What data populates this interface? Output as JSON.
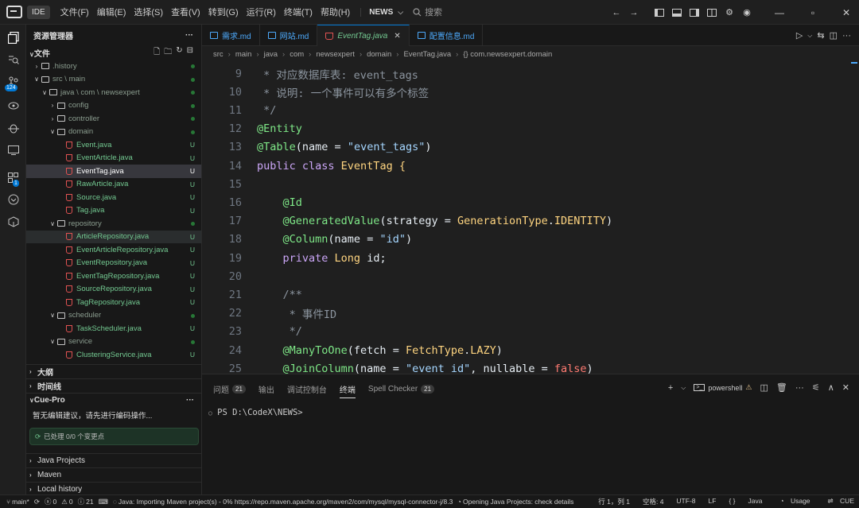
{
  "titlebar": {
    "ide_label": "IDE",
    "menu": [
      "文件(F)",
      "编辑(E)",
      "选择(S)",
      "查看(V)",
      "转到(G)",
      "运行(R)",
      "终端(T)",
      "帮助(H)"
    ],
    "project": "NEWS",
    "search_placeholder": "搜索"
  },
  "activity": {
    "scm_badge": "124",
    "ext_badge": "1"
  },
  "sidebar": {
    "title": "资源管理器",
    "section_files": "文件",
    "tree": [
      {
        "label": ".history",
        "kind": "folder",
        "depth": 1,
        "open": false,
        "status": "dot"
      },
      {
        "label": "src \\ main",
        "kind": "folder",
        "depth": 1,
        "open": true,
        "status": "dot"
      },
      {
        "label": "java \\ com \\ newsexpert",
        "kind": "folder",
        "depth": 2,
        "open": true,
        "status": "dot"
      },
      {
        "label": "config",
        "kind": "folder",
        "depth": 3,
        "open": false,
        "status": "dot"
      },
      {
        "label": "controller",
        "kind": "folder",
        "depth": 3,
        "open": false,
        "status": "dot"
      },
      {
        "label": "domain",
        "kind": "folder",
        "depth": 3,
        "open": true,
        "status": "dot"
      },
      {
        "label": "Event.java",
        "kind": "java",
        "depth": 4,
        "status": "U"
      },
      {
        "label": "EventArticle.java",
        "kind": "java",
        "depth": 4,
        "status": "U"
      },
      {
        "label": "EventTag.java",
        "kind": "java",
        "depth": 4,
        "status": "U",
        "selected": true
      },
      {
        "label": "RawArticle.java",
        "kind": "java",
        "depth": 4,
        "status": "U"
      },
      {
        "label": "Source.java",
        "kind": "java",
        "depth": 4,
        "status": "U"
      },
      {
        "label": "Tag.java",
        "kind": "java",
        "depth": 4,
        "status": "U"
      },
      {
        "label": "repository",
        "kind": "folder",
        "depth": 3,
        "open": true,
        "status": "dot"
      },
      {
        "label": "ArticleRepository.java",
        "kind": "java",
        "depth": 4,
        "status": "U",
        "hover": true
      },
      {
        "label": "EventArticleRepository.java",
        "kind": "java",
        "depth": 4,
        "status": "U"
      },
      {
        "label": "EventRepository.java",
        "kind": "java",
        "depth": 4,
        "status": "U"
      },
      {
        "label": "EventTagRepository.java",
        "kind": "java",
        "depth": 4,
        "status": "U"
      },
      {
        "label": "SourceRepository.java",
        "kind": "java",
        "depth": 4,
        "status": "U"
      },
      {
        "label": "TagRepository.java",
        "kind": "java",
        "depth": 4,
        "status": "U"
      },
      {
        "label": "scheduler",
        "kind": "folder",
        "depth": 3,
        "open": true,
        "status": "dot"
      },
      {
        "label": "TaskScheduler.java",
        "kind": "java",
        "depth": 4,
        "status": "U"
      },
      {
        "label": "service",
        "kind": "folder",
        "depth": 3,
        "open": true,
        "status": "dot"
      },
      {
        "label": "ClusteringService.java",
        "kind": "java",
        "depth": 4,
        "status": "U"
      }
    ],
    "outline": "大纲",
    "timeline": "时间线",
    "cue_title": "Cue-Pro",
    "cue_message": "暂无编辑建议，请先进行编码操作...",
    "cue_status": "已处理 0/0 个变更点",
    "java_projects": "Java Projects",
    "maven": "Maven",
    "local_history": "Local history"
  },
  "tabs": [
    {
      "label": "需求.md",
      "kind": "md"
    },
    {
      "label": "网站.md",
      "kind": "md"
    },
    {
      "label": "EventTag.java",
      "kind": "java",
      "active": true
    },
    {
      "label": "配置信息.md",
      "kind": "md"
    }
  ],
  "breadcrumb": [
    "src",
    "main",
    "java",
    "com",
    "newsexpert",
    "domain",
    "EventTag.java",
    "{} com.newsexpert.domain"
  ],
  "code": {
    "lines": [
      {
        "n": "9",
        "tokens": [
          [
            "cm",
            " * 对应数据库表: event_tags"
          ]
        ]
      },
      {
        "n": "10",
        "tokens": [
          [
            "cm",
            " * 说明: 一个事件可以有多个标签"
          ]
        ]
      },
      {
        "n": "11",
        "tokens": [
          [
            "cm",
            " */"
          ]
        ]
      },
      {
        "n": "12",
        "tokens": [
          [
            "ann",
            "@Entity"
          ]
        ]
      },
      {
        "n": "13",
        "tokens": [
          [
            "ann",
            "@Table"
          ],
          [
            "plain",
            "(name = "
          ],
          [
            "str",
            "\"event_tags\""
          ],
          [
            "plain",
            ")"
          ]
        ]
      },
      {
        "n": "14",
        "tokens": [
          [
            "kw2",
            "public class "
          ],
          [
            "typ",
            "EventTag "
          ],
          [
            "typ",
            "{"
          ]
        ]
      },
      {
        "n": "15",
        "tokens": []
      },
      {
        "n": "16",
        "tokens": [
          [
            "plain",
            "    "
          ],
          [
            "ann",
            "@Id"
          ]
        ]
      },
      {
        "n": "17",
        "tokens": [
          [
            "plain",
            "    "
          ],
          [
            "ann",
            "@GeneratedValue"
          ],
          [
            "plain",
            "(strategy = "
          ],
          [
            "typ",
            "GenerationType"
          ],
          [
            "plain",
            "."
          ],
          [
            "typ",
            "IDENTITY"
          ],
          [
            "plain",
            ")"
          ]
        ]
      },
      {
        "n": "18",
        "tokens": [
          [
            "plain",
            "    "
          ],
          [
            "ann",
            "@Column"
          ],
          [
            "plain",
            "(name = "
          ],
          [
            "str",
            "\"id\""
          ],
          [
            "plain",
            ")"
          ]
        ]
      },
      {
        "n": "19",
        "tokens": [
          [
            "plain",
            "    "
          ],
          [
            "kw2",
            "private "
          ],
          [
            "typ",
            "Long "
          ],
          [
            "plain",
            "id;"
          ]
        ]
      },
      {
        "n": "20",
        "tokens": []
      },
      {
        "n": "21",
        "tokens": [
          [
            "plain",
            "    "
          ],
          [
            "cm",
            "/**"
          ]
        ]
      },
      {
        "n": "22",
        "tokens": [
          [
            "plain",
            "    "
          ],
          [
            "cm",
            " * 事件ID"
          ]
        ]
      },
      {
        "n": "23",
        "tokens": [
          [
            "plain",
            "    "
          ],
          [
            "cm",
            " */"
          ]
        ]
      },
      {
        "n": "24",
        "tokens": [
          [
            "plain",
            "    "
          ],
          [
            "ann",
            "@ManyToOne"
          ],
          [
            "plain",
            "(fetch = "
          ],
          [
            "typ",
            "FetchType"
          ],
          [
            "plain",
            "."
          ],
          [
            "typ",
            "LAZY"
          ],
          [
            "plain",
            ")"
          ]
        ]
      },
      {
        "n": "25",
        "tokens": [
          [
            "plain",
            "    "
          ],
          [
            "ann",
            "@JoinColumn"
          ],
          [
            "plain",
            "(name = "
          ],
          [
            "str",
            "\"event_id\""
          ],
          [
            "plain",
            ", nullable = "
          ],
          [
            "kw",
            "false"
          ],
          [
            "plain",
            ")"
          ]
        ]
      }
    ]
  },
  "panel": {
    "tabs": [
      {
        "label": "问题",
        "count": "21"
      },
      {
        "label": "输出"
      },
      {
        "label": "调试控制台"
      },
      {
        "label": "终端",
        "active": true
      },
      {
        "label": "Spell Checker",
        "count": "21"
      }
    ],
    "shell": "powershell",
    "prompt": "PS D:\\CodeX\\NEWS>"
  },
  "status": {
    "branch": "main*",
    "errors": "0",
    "warnings": "0",
    "infos": "21",
    "java_msg": "Java: Importing Maven project(s) - 0% https://repo.maven.apache.org/maven2/com/mysql/mysql-connector-j/8.3.",
    "opening_msg": "Opening Java Projects: check details",
    "position": "行 1，列 1",
    "spaces": "空格: 4",
    "encoding": "UTF-8",
    "eol": "LF",
    "braces": "{ }",
    "language": "Java",
    "usage": "Usage",
    "cue": "CUE"
  }
}
